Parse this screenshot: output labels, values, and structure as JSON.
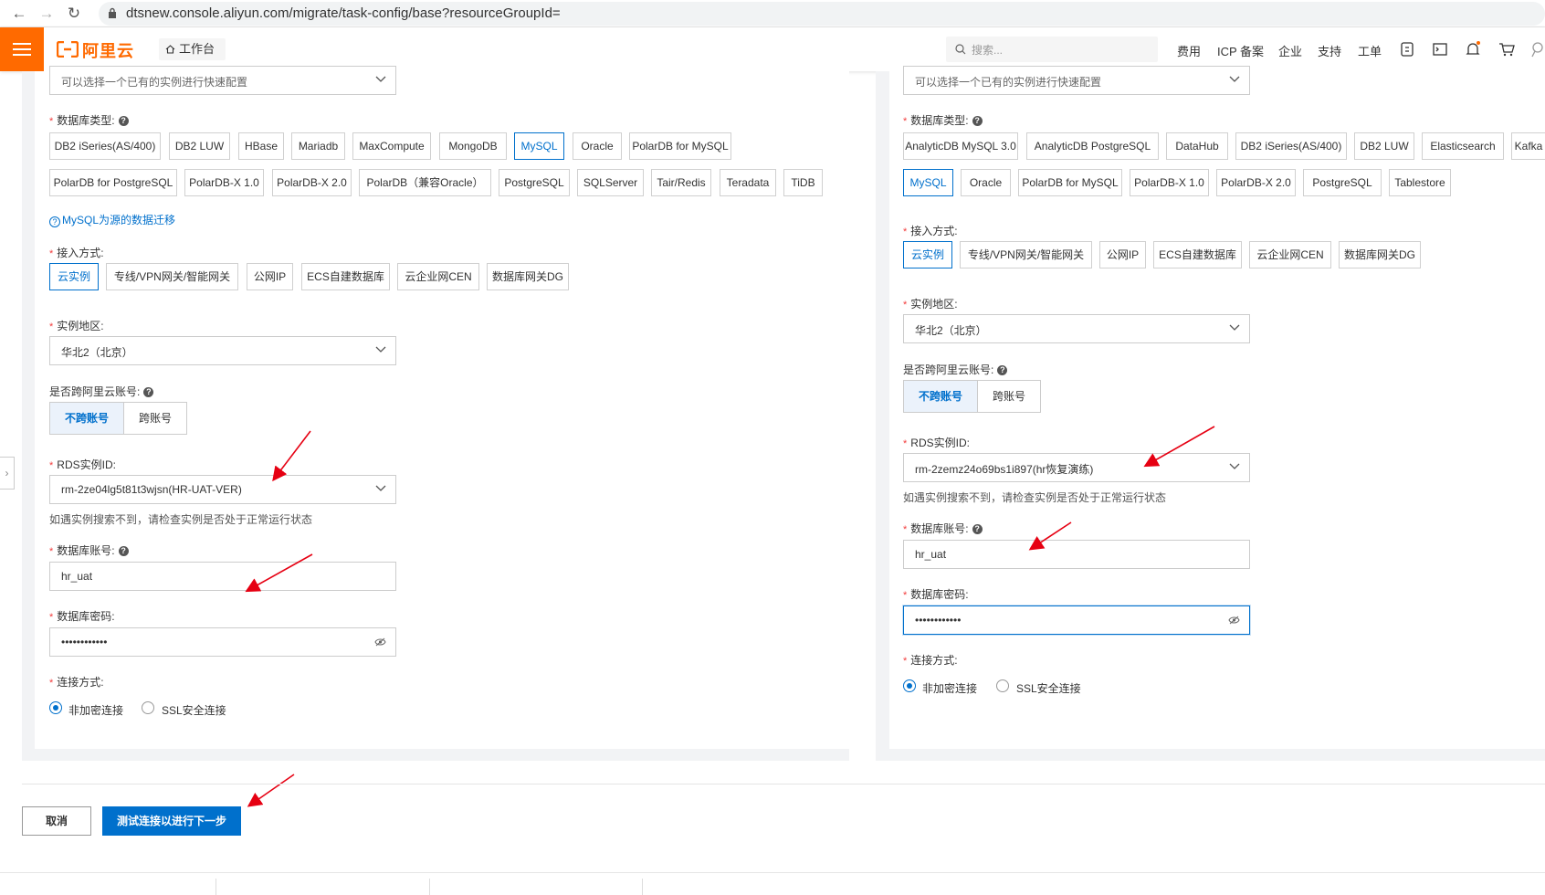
{
  "browser": {
    "url": "dtsnew.console.aliyun.com/migrate/task-config/base?resourceGroupId="
  },
  "header": {
    "logo_text": "阿里云",
    "workbench": "工作台",
    "search_placeholder": "搜索...",
    "nav": [
      "费用",
      "ICP 备案",
      "企业",
      "支持",
      "工单"
    ],
    "brand_color": "#ff6a00"
  },
  "source": {
    "quick_config_placeholder": "可以选择一个已有的实例进行快速配置",
    "db_type_label": "数据库类型:",
    "db_types": [
      "DB2 iSeries(AS/400)",
      "DB2 LUW",
      "HBase",
      "Mariadb",
      "MaxCompute",
      "MongoDB",
      "MySQL",
      "Oracle",
      "PolarDB for MySQL",
      "PolarDB for PostgreSQL",
      "PolarDB-X 1.0",
      "PolarDB-X 2.0",
      "PolarDB（兼容Oracle）",
      "PostgreSQL",
      "SQLServer",
      "Tair/Redis",
      "Teradata",
      "TiDB"
    ],
    "selected_db_type": "MySQL",
    "migration_link": "MySQL为源的数据迁移",
    "access_label": "接入方式:",
    "access_methods": [
      "云实例",
      "专线/VPN网关/智能网关",
      "公网IP",
      "ECS自建数据库",
      "云企业网CEN",
      "数据库网关DG"
    ],
    "region_label": "实例地区:",
    "region_value": "华北2（北京）",
    "cross_account_label": "是否跨阿里云账号:",
    "cross_options": [
      "不跨账号",
      "跨账号"
    ],
    "rds_label": "RDS实例ID:",
    "rds_value": "rm-2ze04lg5t81t3wjsn(HR-UAT-VER)",
    "rds_hint": "如遇实例搜索不到，请检查实例是否处于正常运行状态",
    "account_label": "数据库账号:",
    "account_value": "hr_uat",
    "password_label": "数据库密码:",
    "password_value": "••••••••••••",
    "conn_label": "连接方式:",
    "conn_options": [
      "非加密连接",
      "SSL安全连接"
    ]
  },
  "target": {
    "quick_config_placeholder": "可以选择一个已有的实例进行快速配置",
    "db_type_label": "数据库类型:",
    "db_types": [
      "AnalyticDB MySQL 3.0",
      "AnalyticDB PostgreSQL",
      "DataHub",
      "DB2 iSeries(AS/400)",
      "DB2 LUW",
      "Elasticsearch",
      "Kafka",
      "MySQL",
      "Oracle",
      "PolarDB for MySQL",
      "PolarDB-X 1.0",
      "PolarDB-X 2.0",
      "PostgreSQL",
      "Tablestore"
    ],
    "selected_db_type": "MySQL",
    "access_label": "接入方式:",
    "access_methods": [
      "云实例",
      "专线/VPN网关/智能网关",
      "公网IP",
      "ECS自建数据库",
      "云企业网CEN",
      "数据库网关DG"
    ],
    "region_label": "实例地区:",
    "region_value": "华北2（北京）",
    "cross_account_label": "是否跨阿里云账号:",
    "cross_options": [
      "不跨账号",
      "跨账号"
    ],
    "rds_label": "RDS实例ID:",
    "rds_value": "rm-2zemz24o69bs1i897(hr恢复演练)",
    "rds_hint": "如遇实例搜索不到，请检查实例是否处于正常运行状态",
    "account_label": "数据库账号:",
    "account_value": "hr_uat",
    "password_label": "数据库密码:",
    "password_value": "••••••••••••",
    "conn_label": "连接方式:",
    "conn_options": [
      "非加密连接",
      "SSL安全连接"
    ]
  },
  "footer": {
    "cancel": "取消",
    "test_next": "测试连接以进行下一步"
  },
  "accent_color": "#0070cc"
}
